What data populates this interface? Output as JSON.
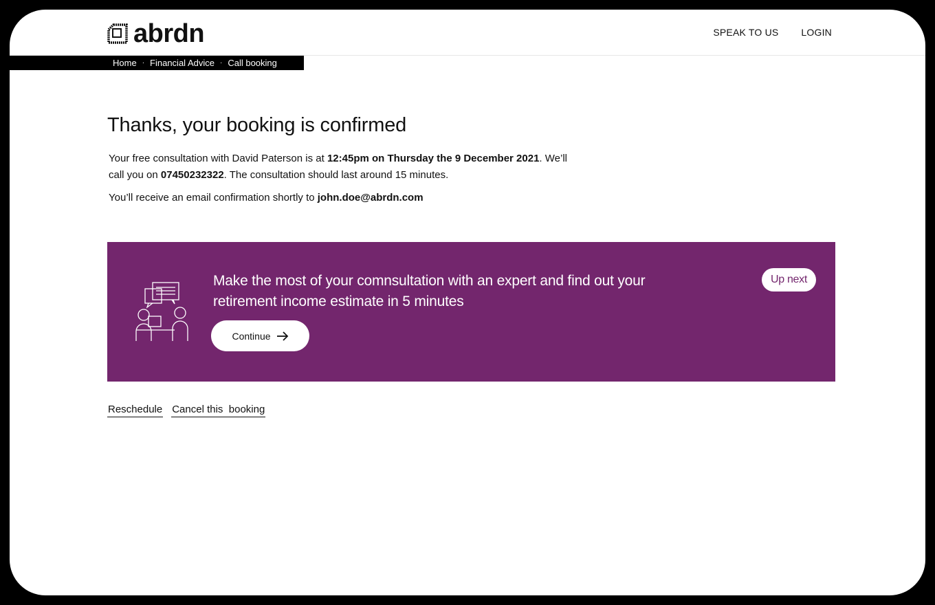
{
  "brand": {
    "name": "abrdn"
  },
  "nav": {
    "speak": "SPEAK TO US",
    "login": "LOGIN"
  },
  "breadcrumb": {
    "items": [
      "Home",
      "Financial Advice",
      "Call booking"
    ],
    "separator": "·"
  },
  "confirmation": {
    "title": "Thanks, your booking is confirmed",
    "p1_a": "Your free consultation with David Paterson is at ",
    "p1_time": "12:45pm on Thursday the 9 December 2021",
    "p1_b": ". We’ll call you on ",
    "p1_phone": "07450232322",
    "p1_c": ". The consultation should last around 15 minutes.",
    "p2_a": "You’ll receive an email confirmation shortly to ",
    "p2_email": "john.doe@abrdn.com"
  },
  "promo": {
    "text": "Make the most of your comnsultation with an expert and find out your retirement income estimate in 5 minutes",
    "badge": "Up next",
    "button": "Continue",
    "background": "#73266d",
    "illustration_icon": "consultation-icon"
  },
  "actions": {
    "reschedule": "Reschedule",
    "cancel": "Cancel this  booking"
  }
}
